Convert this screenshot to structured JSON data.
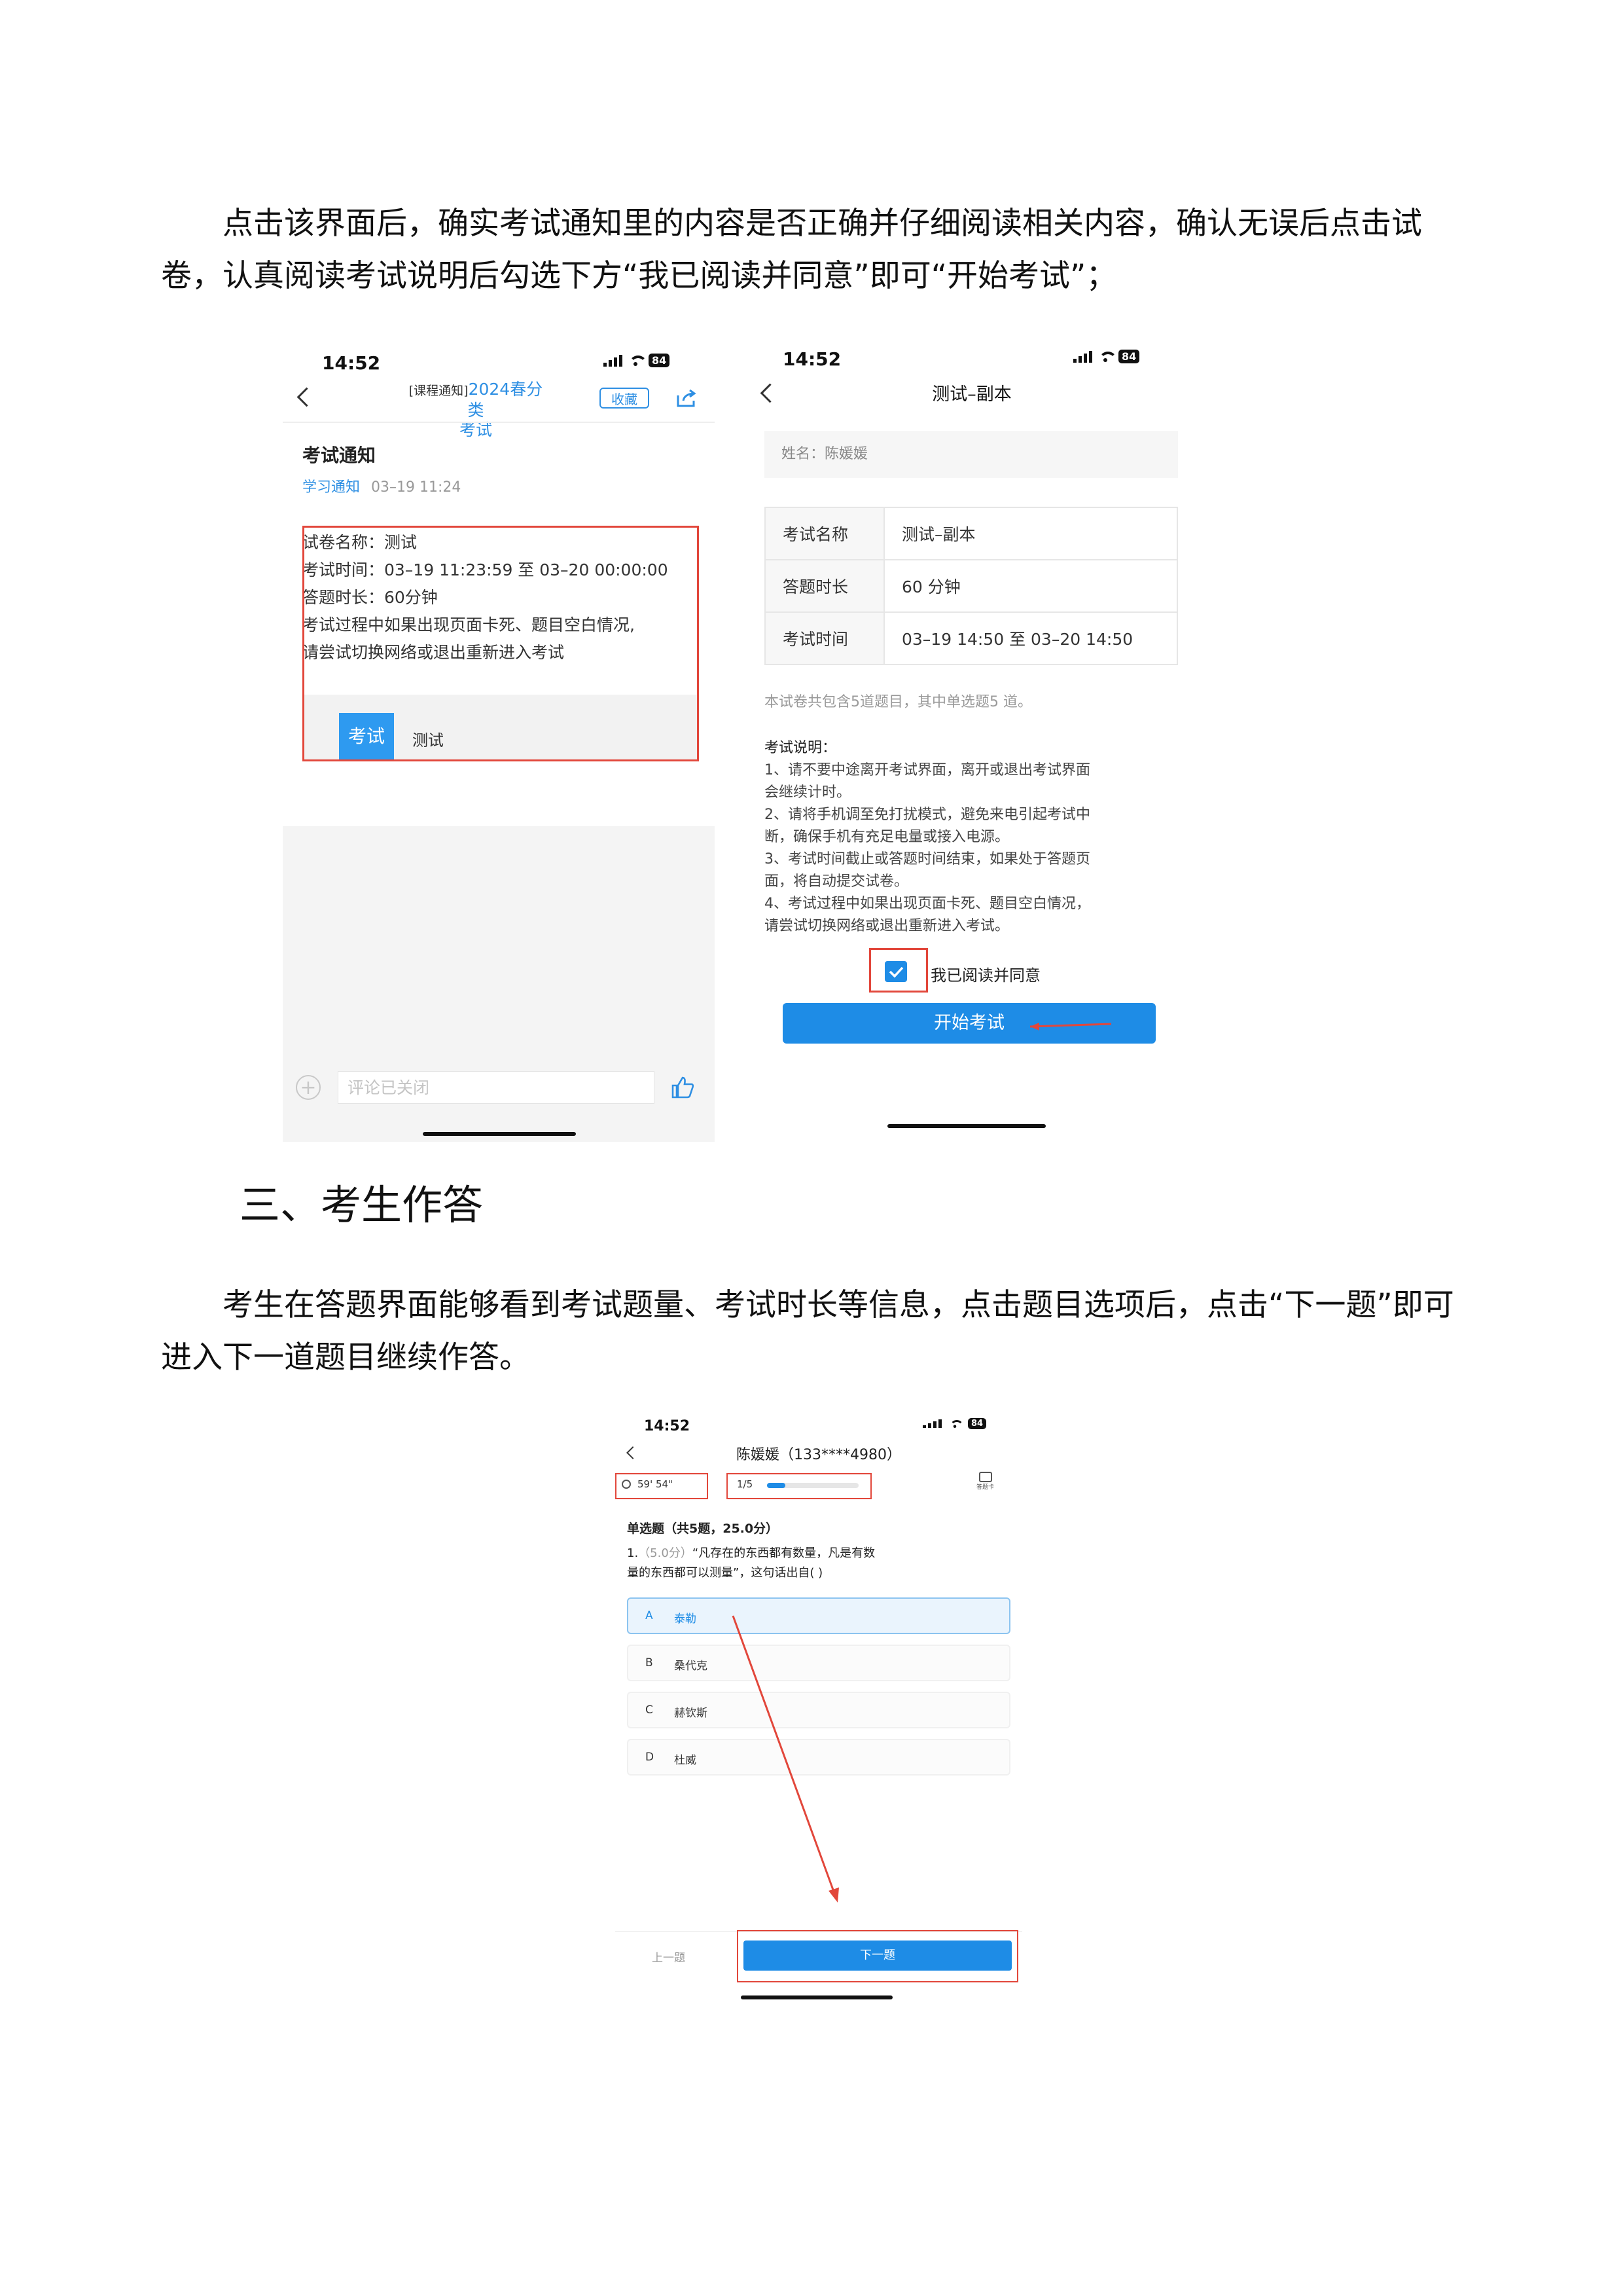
{
  "doc": {
    "para1": "点击该界面后，确实考试通知里的内容是否正确并仔细阅读相关内容，确认无误后点击试卷，认真阅读考试说明后勾选下方“我已阅读并同意”即可“开始考试”；",
    "heading3": "三、考生作答",
    "para2": "考生在答题界面能够看到考试题量、考试时长等信息，点击题目选项后，点击“下一题”即可进入下一道题目继续作答。"
  },
  "phone1": {
    "time": "14:52",
    "battery": "84",
    "title_tag": "[课程通知]",
    "title_blue": "2024春分类",
    "title_line2": "考试",
    "collect_label": "收藏",
    "section_title": "考试通知",
    "sub_link": "学习通知",
    "sub_date": "03–19 11:24",
    "lines": [
      "试卷名称：测试",
      "考试时间：03–19 11:23:59 至 03–20 00:00:00",
      "答题时长：60分钟",
      "考试过程中如果出现页面卡死、题目空白情况,",
      "请尝试切换网络或退出重新进入考试"
    ],
    "exam_badge": "考试",
    "exam_name": "测试",
    "comment_placeholder": "评论已关闭"
  },
  "phone2": {
    "time": "14:52",
    "battery": "84",
    "nav_title": "测试–副本",
    "name_label": "姓名：陈媛媛",
    "rows": [
      {
        "key": "考试名称",
        "value": "测试–副本"
      },
      {
        "key": "答题时长",
        "value": "60 分钟"
      },
      {
        "key": "考试时间",
        "value": "03–19 14:50 至 03–20 14:50"
      }
    ],
    "summary": "本试卷共包含5道题目，其中单选题5 道。",
    "notes_title": "考试说明：",
    "notes": [
      "1、请不要中途离开考试界面，离开或退出考试界面",
      "会继续计时。",
      "2、请将手机调至免打扰模式，避免来电引起考试中",
      "断，确保手机有充足电量或接入电源。",
      "3、考试时间截止或答题时间结束，如果处于答题页",
      "面，将自动提交试卷。",
      "4、考试过程中如果出现页面卡死、题目空白情况，",
      "请尝试切换网络或退出重新进入考试。"
    ],
    "agree_label": "我已阅读并同意",
    "start_label": "开始考试"
  },
  "phone3": {
    "time": "14:52",
    "battery": "84",
    "nav_title": "陈媛媛（133****4980）",
    "timer": "59' 54\"",
    "progress_text": "1/5",
    "progress_fraction": 0.2,
    "answer_card": "答题卡",
    "q_type": "单选题（共5题，25.0分）",
    "q_score": "（5.0分）",
    "q_text_1": "“凡存在的东西都有数量，凡是有数",
    "q_text_2": "量的东西都可以测量”，这句话出自(   )",
    "q_num": "1.",
    "options": [
      {
        "letter": "A",
        "text": "泰勒"
      },
      {
        "letter": "B",
        "text": "桑代克"
      },
      {
        "letter": "C",
        "text": "赫钦斯"
      },
      {
        "letter": "D",
        "text": "杜威"
      }
    ],
    "prev_label": "上一题",
    "next_label": "下一题"
  },
  "colors": {
    "accent": "#1e8ce6",
    "annotation": "#e2473b"
  }
}
